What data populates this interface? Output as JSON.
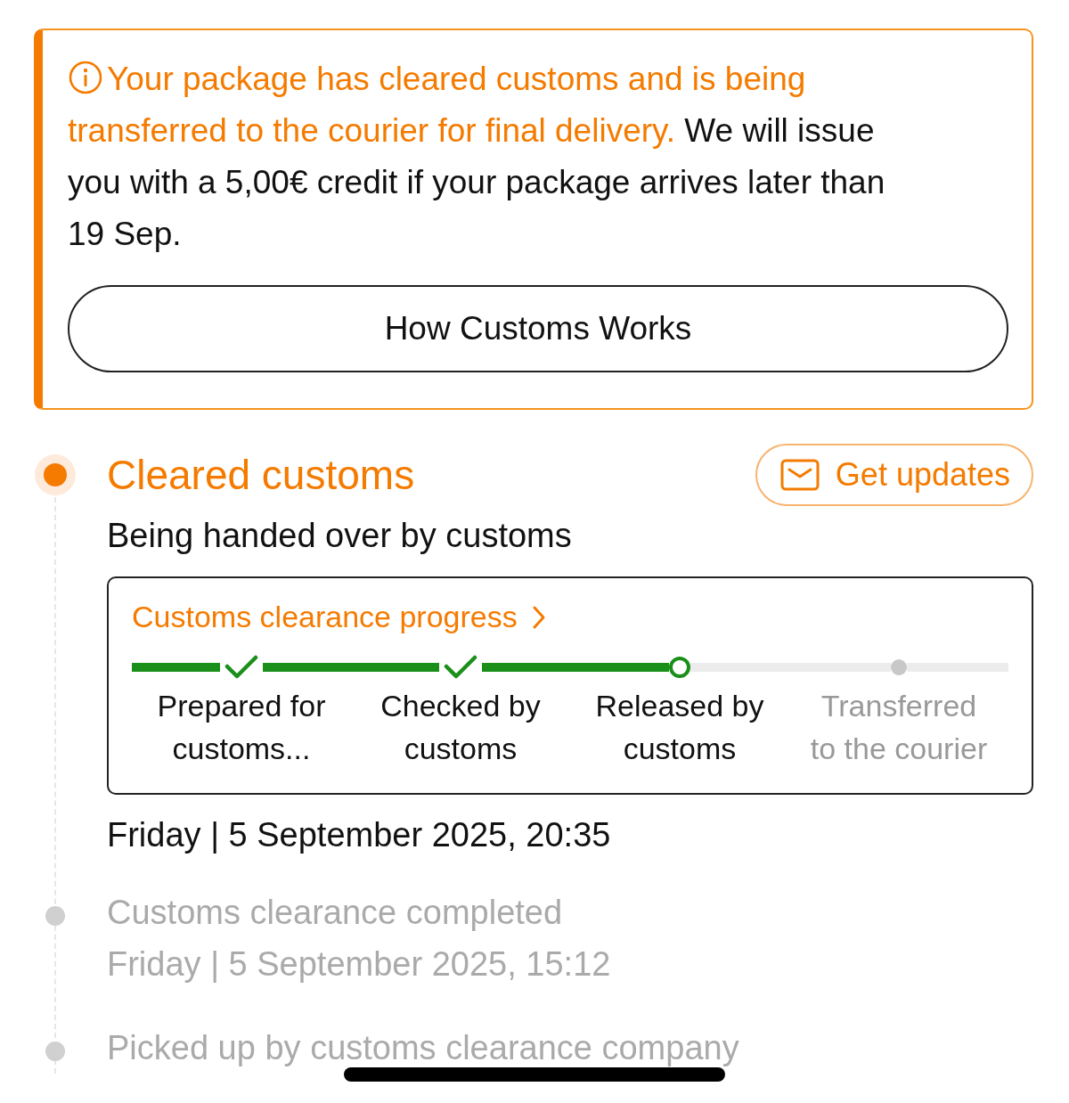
{
  "notice": {
    "highlight": "Your package has cleared customs and is being transferred to the courier for final delivery.",
    "text": "We will issue you with a 5,00€ credit if your package arrives later than 19 Sep.",
    "button": "How Customs Works"
  },
  "current_event": {
    "title": "Cleared customs",
    "subtitle": "Being handed over by customs",
    "updates_button": "Get updates",
    "date": "Friday | 5 September 2025, 20:35",
    "progress_card": {
      "title": "Customs clearance progress",
      "steps": [
        {
          "label": "Prepared for customs...",
          "completed": true,
          "current": false
        },
        {
          "label": "Checked by customs",
          "completed": true,
          "current": false
        },
        {
          "label": "Released by customs",
          "completed": false,
          "current": true
        },
        {
          "label": "Transferred to the courier",
          "completed": false,
          "current": false
        }
      ]
    }
  },
  "past_events": [
    {
      "title": "Customs clearance completed",
      "date": "Friday | 5 September 2025, 15:12"
    },
    {
      "title": "Picked up by customs clearance company"
    }
  ]
}
